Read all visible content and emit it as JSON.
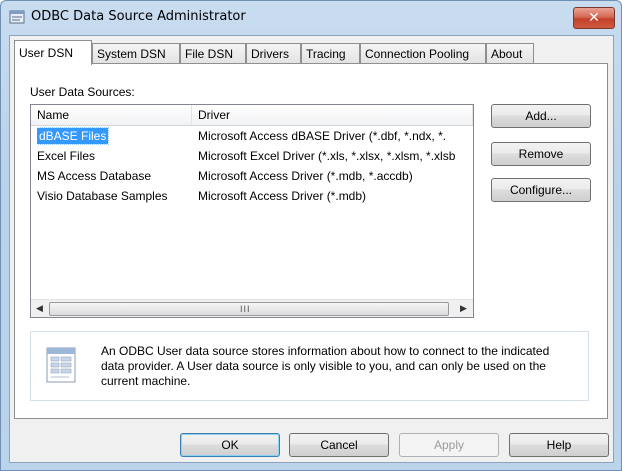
{
  "window": {
    "title": "ODBC Data Source Administrator",
    "close_label": "✕"
  },
  "tabs": [
    {
      "label": "User DSN",
      "active": true
    },
    {
      "label": "System DSN",
      "active": false
    },
    {
      "label": "File DSN",
      "active": false
    },
    {
      "label": "Drivers",
      "active": false
    },
    {
      "label": "Tracing",
      "active": false
    },
    {
      "label": "Connection Pooling",
      "active": false
    },
    {
      "label": "About",
      "active": false
    }
  ],
  "panel": {
    "section_label": "User Data Sources:",
    "columns": {
      "name": "Name",
      "driver": "Driver"
    },
    "rows": [
      {
        "name": "dBASE Files",
        "driver": "Microsoft Access dBASE Driver (*.dbf, *.ndx, *.",
        "selected": true
      },
      {
        "name": "Excel Files",
        "driver": "Microsoft Excel Driver (*.xls, *.xlsx, *.xlsm, *.xlsb",
        "selected": false
      },
      {
        "name": "MS Access Database",
        "driver": "Microsoft Access Driver (*.mdb, *.accdb)",
        "selected": false
      },
      {
        "name": "Visio Database Samples",
        "driver": "Microsoft Access Driver (*.mdb)",
        "selected": false
      }
    ],
    "scrollbar": {
      "left_arrow": "◀",
      "right_arrow": "▶",
      "grip": "III"
    },
    "side_buttons": {
      "add": "Add...",
      "remove": "Remove",
      "configure": "Configure..."
    },
    "info_text": "An ODBC User data source stores information about how to connect to the indicated data provider.   A User data source is only visible to you, and can only be used on the current machine."
  },
  "footer": {
    "ok": "OK",
    "cancel": "Cancel",
    "apply": "Apply",
    "help": "Help"
  },
  "icons": {
    "title": "odbc-window-icon",
    "info": "datasource-document-icon"
  },
  "colors": {
    "selection": "#3399ff",
    "frame": "#b9d1ea",
    "close": "#c3412b"
  }
}
